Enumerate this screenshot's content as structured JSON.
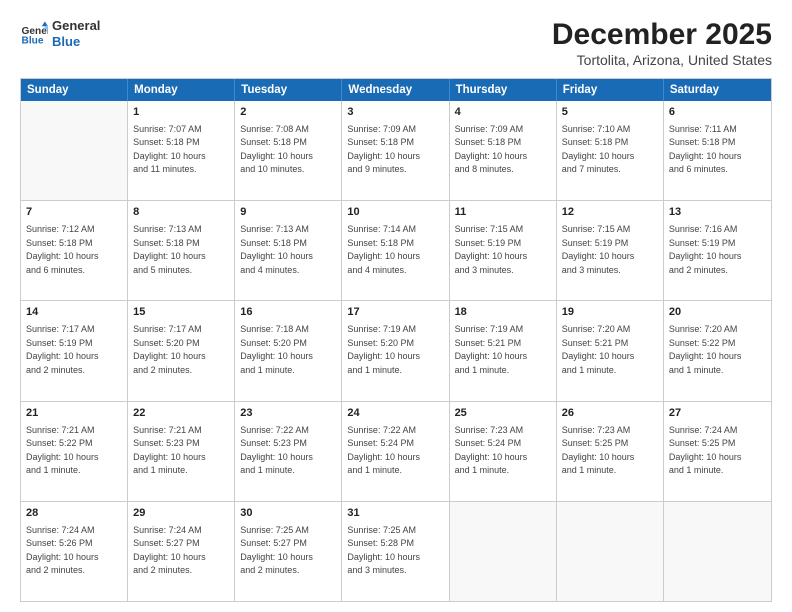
{
  "logo": {
    "general": "General",
    "blue": "Blue"
  },
  "title": "December 2025",
  "subtitle": "Tortolita, Arizona, United States",
  "headers": [
    "Sunday",
    "Monday",
    "Tuesday",
    "Wednesday",
    "Thursday",
    "Friday",
    "Saturday"
  ],
  "rows": [
    [
      {
        "date": "",
        "info": ""
      },
      {
        "date": "1",
        "info": "Sunrise: 7:07 AM\nSunset: 5:18 PM\nDaylight: 10 hours\nand 11 minutes."
      },
      {
        "date": "2",
        "info": "Sunrise: 7:08 AM\nSunset: 5:18 PM\nDaylight: 10 hours\nand 10 minutes."
      },
      {
        "date": "3",
        "info": "Sunrise: 7:09 AM\nSunset: 5:18 PM\nDaylight: 10 hours\nand 9 minutes."
      },
      {
        "date": "4",
        "info": "Sunrise: 7:09 AM\nSunset: 5:18 PM\nDaylight: 10 hours\nand 8 minutes."
      },
      {
        "date": "5",
        "info": "Sunrise: 7:10 AM\nSunset: 5:18 PM\nDaylight: 10 hours\nand 7 minutes."
      },
      {
        "date": "6",
        "info": "Sunrise: 7:11 AM\nSunset: 5:18 PM\nDaylight: 10 hours\nand 6 minutes."
      }
    ],
    [
      {
        "date": "7",
        "info": "Sunrise: 7:12 AM\nSunset: 5:18 PM\nDaylight: 10 hours\nand 6 minutes."
      },
      {
        "date": "8",
        "info": "Sunrise: 7:13 AM\nSunset: 5:18 PM\nDaylight: 10 hours\nand 5 minutes."
      },
      {
        "date": "9",
        "info": "Sunrise: 7:13 AM\nSunset: 5:18 PM\nDaylight: 10 hours\nand 4 minutes."
      },
      {
        "date": "10",
        "info": "Sunrise: 7:14 AM\nSunset: 5:18 PM\nDaylight: 10 hours\nand 4 minutes."
      },
      {
        "date": "11",
        "info": "Sunrise: 7:15 AM\nSunset: 5:19 PM\nDaylight: 10 hours\nand 3 minutes."
      },
      {
        "date": "12",
        "info": "Sunrise: 7:15 AM\nSunset: 5:19 PM\nDaylight: 10 hours\nand 3 minutes."
      },
      {
        "date": "13",
        "info": "Sunrise: 7:16 AM\nSunset: 5:19 PM\nDaylight: 10 hours\nand 2 minutes."
      }
    ],
    [
      {
        "date": "14",
        "info": "Sunrise: 7:17 AM\nSunset: 5:19 PM\nDaylight: 10 hours\nand 2 minutes."
      },
      {
        "date": "15",
        "info": "Sunrise: 7:17 AM\nSunset: 5:20 PM\nDaylight: 10 hours\nand 2 minutes."
      },
      {
        "date": "16",
        "info": "Sunrise: 7:18 AM\nSunset: 5:20 PM\nDaylight: 10 hours\nand 1 minute."
      },
      {
        "date": "17",
        "info": "Sunrise: 7:19 AM\nSunset: 5:20 PM\nDaylight: 10 hours\nand 1 minute."
      },
      {
        "date": "18",
        "info": "Sunrise: 7:19 AM\nSunset: 5:21 PM\nDaylight: 10 hours\nand 1 minute."
      },
      {
        "date": "19",
        "info": "Sunrise: 7:20 AM\nSunset: 5:21 PM\nDaylight: 10 hours\nand 1 minute."
      },
      {
        "date": "20",
        "info": "Sunrise: 7:20 AM\nSunset: 5:22 PM\nDaylight: 10 hours\nand 1 minute."
      }
    ],
    [
      {
        "date": "21",
        "info": "Sunrise: 7:21 AM\nSunset: 5:22 PM\nDaylight: 10 hours\nand 1 minute."
      },
      {
        "date": "22",
        "info": "Sunrise: 7:21 AM\nSunset: 5:23 PM\nDaylight: 10 hours\nand 1 minute."
      },
      {
        "date": "23",
        "info": "Sunrise: 7:22 AM\nSunset: 5:23 PM\nDaylight: 10 hours\nand 1 minute."
      },
      {
        "date": "24",
        "info": "Sunrise: 7:22 AM\nSunset: 5:24 PM\nDaylight: 10 hours\nand 1 minute."
      },
      {
        "date": "25",
        "info": "Sunrise: 7:23 AM\nSunset: 5:24 PM\nDaylight: 10 hours\nand 1 minute."
      },
      {
        "date": "26",
        "info": "Sunrise: 7:23 AM\nSunset: 5:25 PM\nDaylight: 10 hours\nand 1 minute."
      },
      {
        "date": "27",
        "info": "Sunrise: 7:24 AM\nSunset: 5:25 PM\nDaylight: 10 hours\nand 1 minute."
      }
    ],
    [
      {
        "date": "28",
        "info": "Sunrise: 7:24 AM\nSunset: 5:26 PM\nDaylight: 10 hours\nand 2 minutes."
      },
      {
        "date": "29",
        "info": "Sunrise: 7:24 AM\nSunset: 5:27 PM\nDaylight: 10 hours\nand 2 minutes."
      },
      {
        "date": "30",
        "info": "Sunrise: 7:25 AM\nSunset: 5:27 PM\nDaylight: 10 hours\nand 2 minutes."
      },
      {
        "date": "31",
        "info": "Sunrise: 7:25 AM\nSunset: 5:28 PM\nDaylight: 10 hours\nand 3 minutes."
      },
      {
        "date": "",
        "info": ""
      },
      {
        "date": "",
        "info": ""
      },
      {
        "date": "",
        "info": ""
      }
    ]
  ]
}
